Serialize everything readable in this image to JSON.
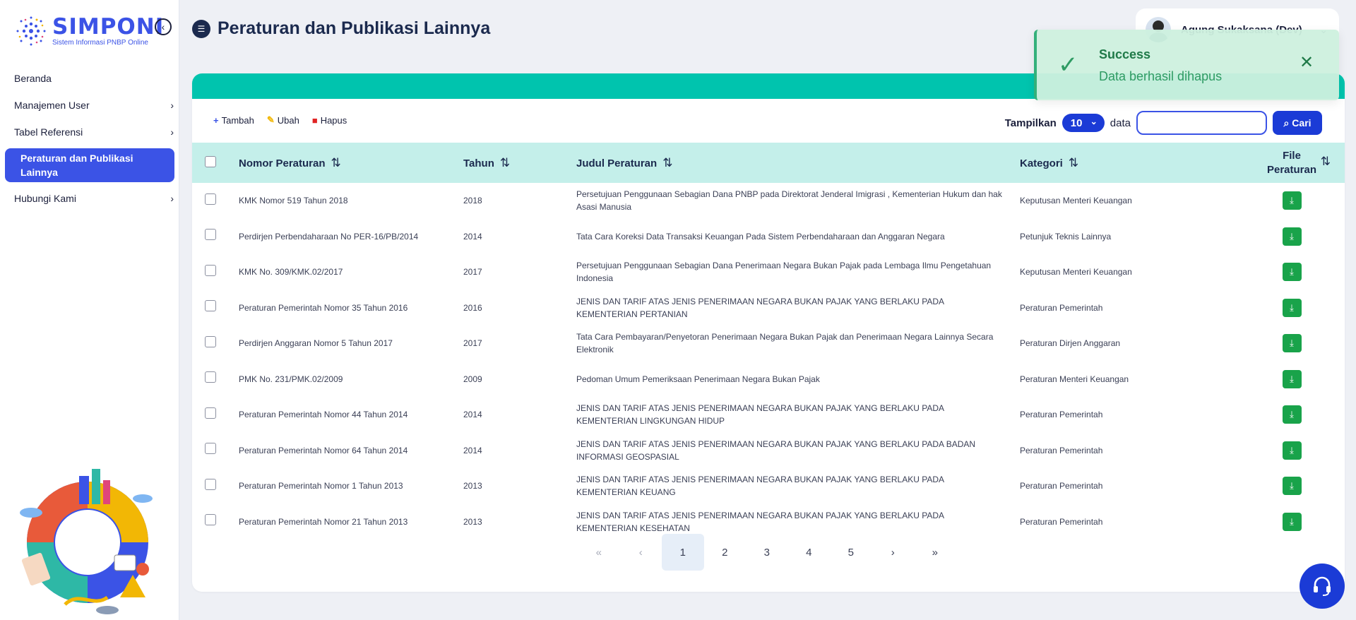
{
  "app": {
    "logo_title": "SIMPONI",
    "logo_subtitle": "Sistem Informasi PNBP Online"
  },
  "sidebar": {
    "items": [
      {
        "label": "Beranda",
        "has_children": false,
        "active": false
      },
      {
        "label": "Manajemen User",
        "has_children": true,
        "active": false
      },
      {
        "label": "Tabel Referensi",
        "has_children": true,
        "active": false
      },
      {
        "label": "Peraturan dan Publikasi Lainnya",
        "has_children": false,
        "active": true
      },
      {
        "label": "Hubungi Kami",
        "has_children": true,
        "active": false
      }
    ]
  },
  "header": {
    "title": "Peraturan dan Publikasi Lainnya",
    "user_name": "Agung Sukaksana (Dev)"
  },
  "toast": {
    "title": "Success",
    "message": "Data berhasil dihapus"
  },
  "toolbar": {
    "add_label": "Tambah",
    "edit_label": "Ubah",
    "delete_label": "Hapus"
  },
  "search": {
    "show_label": "Tampilkan",
    "page_size": "10",
    "data_label": "data",
    "input_value": "",
    "placeholder": "",
    "button_label": "Cari"
  },
  "table": {
    "columns": [
      "Nomor Peraturan",
      "Tahun",
      "Judul Peraturan",
      "Kategori",
      "File Peraturan"
    ],
    "rows": [
      {
        "nomor": "KMK Nomor 519 Tahun 2018",
        "tahun": "2018",
        "judul": "Persetujuan Penggunaan Sebagian Dana PNBP pada Direktorat Jenderal Imigrasi , Kementerian Hukum dan hak Asasi Manusia",
        "kategori": "Keputusan Menteri Keuangan"
      },
      {
        "nomor": "Perdirjen Perbendaharaan No PER-16/PB/2014",
        "tahun": "2014",
        "judul": "Tata Cara Koreksi Data Transaksi Keuangan Pada Sistem Perbendaharaan dan Anggaran Negara",
        "kategori": "Petunjuk Teknis Lainnya"
      },
      {
        "nomor": "KMK No. 309/KMK.02/2017",
        "tahun": "2017",
        "judul": "Persetujuan Penggunaan Sebagian Dana Penerimaan Negara Bukan Pajak pada Lembaga Ilmu Pengetahuan Indonesia",
        "kategori": "Keputusan Menteri Keuangan"
      },
      {
        "nomor": "Peraturan Pemerintah Nomor 35 Tahun 2016",
        "tahun": "2016",
        "judul": "JENIS DAN TARIF ATAS JENIS PENERIMAAN NEGARA BUKAN PAJAK YANG BERLAKU PADA KEMENTERIAN PERTANIAN",
        "kategori": "Peraturan Pemerintah"
      },
      {
        "nomor": "Perdirjen Anggaran Nomor 5 Tahun 2017",
        "tahun": "2017",
        "judul": "Tata Cara Pembayaran/Penyetoran Penerimaan Negara Bukan Pajak dan Penerimaan Negara Lainnya Secara Elektronik",
        "kategori": "Peraturan Dirjen Anggaran"
      },
      {
        "nomor": "PMK No. 231/PMK.02/2009",
        "tahun": "2009",
        "judul": "Pedoman Umum Pemeriksaan Penerimaan Negara Bukan Pajak",
        "kategori": "Peraturan Menteri Keuangan"
      },
      {
        "nomor": "Peraturan Pemerintah Nomor 44 Tahun 2014",
        "tahun": "2014",
        "judul": "JENIS DAN TARIF ATAS JENIS PENERIMAAN NEGARA BUKAN PAJAK YANG BERLAKU PADA KEMENTERIAN LINGKUNGAN HIDUP",
        "kategori": "Peraturan Pemerintah"
      },
      {
        "nomor": "Peraturan Pemerintah Nomor 64 Tahun 2014",
        "tahun": "2014",
        "judul": "JENIS DAN TARIF ATAS JENIS PENERIMAAN NEGARA BUKAN PAJAK YANG BERLAKU PADA BADAN INFORMASI GEOSPASIAL",
        "kategori": "Peraturan Pemerintah"
      },
      {
        "nomor": "Peraturan Pemerintah Nomor 1 Tahun 2013",
        "tahun": "2013",
        "judul": "JENIS DAN TARIF ATAS JENIS PENERIMAAN NEGARA BUKAN PAJAK YANG BERLAKU PADA KEMENTERIAN KEUANG",
        "kategori": "Peraturan Pemerintah"
      },
      {
        "nomor": "Peraturan Pemerintah Nomor 21 Tahun 2013",
        "tahun": "2013",
        "judul": "JENIS DAN TARIF ATAS JENIS PENERIMAAN NEGARA BUKAN PAJAK YANG BERLAKU PADA KEMENTERIAN KESEHATAN",
        "kategori": "Peraturan Pemerintah"
      }
    ]
  },
  "pagination": {
    "first": "«",
    "prev": "‹",
    "pages": [
      "1",
      "2",
      "3",
      "4",
      "5"
    ],
    "current": "1",
    "next": "›",
    "last": "»"
  },
  "icons": {
    "collapse": "chevron-left-circle-icon",
    "page_title": "list-icon",
    "download": "download-icon",
    "help": "headset-icon"
  },
  "colors": {
    "primary": "#3b53e6",
    "accent": "#00c4ae",
    "table_header": "#c4efea",
    "download_button": "#19a34a",
    "toast_bg": "#cdf0de"
  }
}
